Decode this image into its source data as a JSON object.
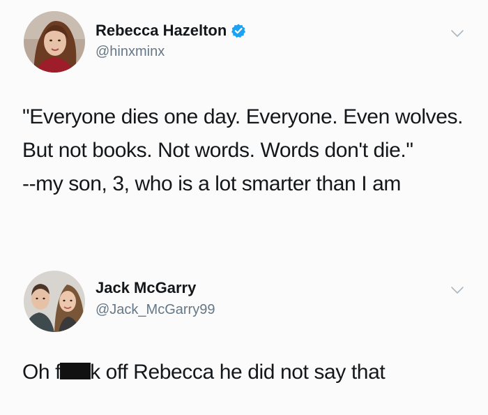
{
  "tweets": [
    {
      "display_name": "Rebecca Hazelton",
      "handle": "@hinxminx",
      "verified": true,
      "body_lines": [
        "\"Everyone dies one day. Everyone. Even wolves. But not books. Not words. Words don't die.\"",
        "--my son, 3, who is a lot smarter than I am"
      ]
    },
    {
      "display_name": "Jack McGarry",
      "handle": "@Jack_McGarry99",
      "verified": false,
      "body_before": "Oh f",
      "body_after": "k off Rebecca he did not say that"
    }
  ],
  "icons": {
    "verified": "verified-badge-icon",
    "menu": "chevron-down-icon"
  },
  "colors": {
    "verified_blue": "#1da1f2",
    "handle_gray": "#657786",
    "text": "#14171a"
  }
}
